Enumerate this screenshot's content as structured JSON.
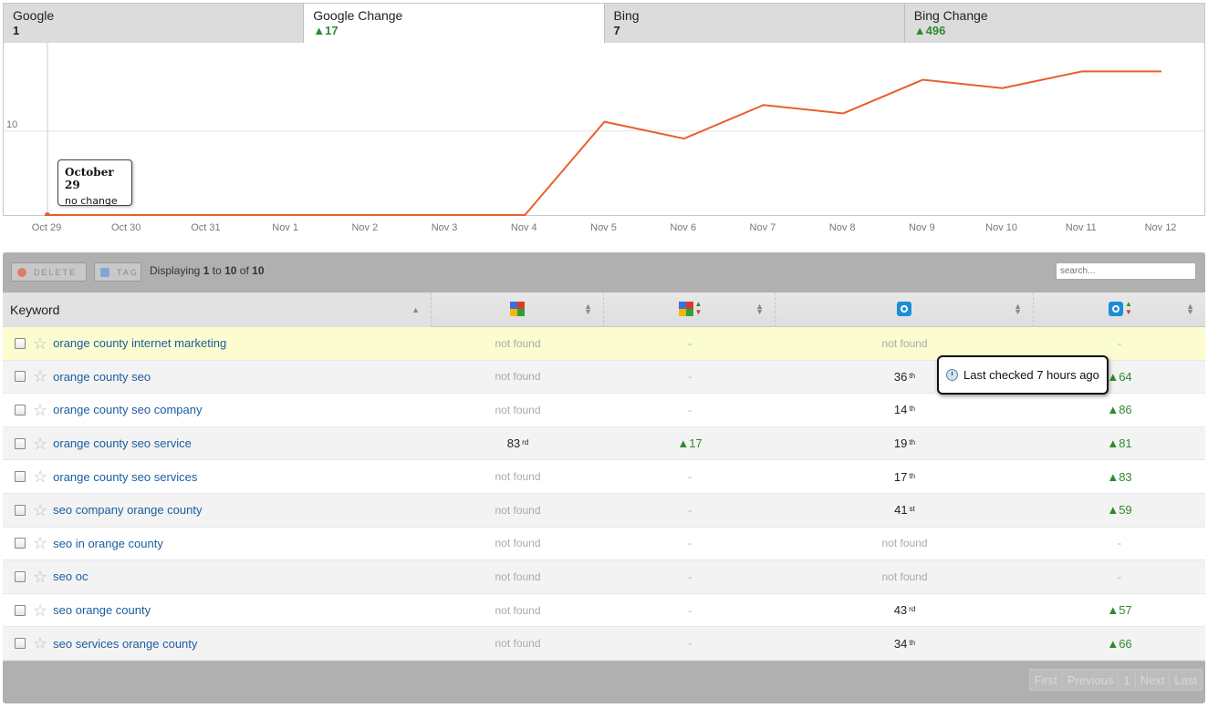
{
  "tabs": [
    {
      "label": "Google",
      "value": "1",
      "active": false,
      "positive": false
    },
    {
      "label": "Google Change",
      "value": "▲17",
      "active": true,
      "positive": true
    },
    {
      "label": "Bing",
      "value": "7",
      "active": false,
      "positive": false
    },
    {
      "label": "Bing Change",
      "value": "▲496",
      "active": false,
      "positive": true
    }
  ],
  "chart_data": {
    "type": "line",
    "categories": [
      "Oct 29",
      "Oct 30",
      "Oct 31",
      "Nov 1",
      "Nov 2",
      "Nov 3",
      "Nov 4",
      "Nov 5",
      "Nov 6",
      "Nov 7",
      "Nov 8",
      "Nov 9",
      "Nov 10",
      "Nov 11",
      "Nov 12"
    ],
    "values": [
      0,
      0,
      0,
      0,
      0,
      0,
      0,
      11.1,
      9.1,
      13.1,
      12.1,
      16.1,
      15.1,
      17.1,
      17.1
    ],
    "y_tick_labels": [
      "10"
    ],
    "ylim": [
      0,
      20.5
    ],
    "grid": true,
    "line_color": "#e8602c",
    "tooltip": {
      "title": "October 29",
      "text": "no change"
    }
  },
  "toolbar": {
    "delete_label": "DELETE",
    "tag_label": "TAG",
    "displaying_prefix": "Displaying",
    "displaying_from": "1",
    "displaying_to_word": "to",
    "displaying_to": "10",
    "displaying_of_word": "of",
    "displaying_total": "10",
    "search_placeholder": "search..."
  },
  "table": {
    "keyword_header": "Keyword",
    "rows": [
      {
        "keyword": "orange county internet marketing",
        "google": "not found",
        "google_sup": "",
        "gchange": "-",
        "bing": "not found",
        "bing_sup": "",
        "bchange": "-"
      },
      {
        "keyword": "orange county seo",
        "google": "not found",
        "google_sup": "",
        "gchange": "-",
        "bing": "36",
        "bing_sup": "th",
        "bchange": "▲64"
      },
      {
        "keyword": "orange county seo company",
        "google": "not found",
        "google_sup": "",
        "gchange": "-",
        "bing": "14",
        "bing_sup": "th",
        "bchange": "▲86"
      },
      {
        "keyword": "orange county seo service",
        "google": "83",
        "google_sup": "rd",
        "gchange": "▲17",
        "bing": "19",
        "bing_sup": "th",
        "bchange": "▲81"
      },
      {
        "keyword": "orange county seo services",
        "google": "not found",
        "google_sup": "",
        "gchange": "-",
        "bing": "17",
        "bing_sup": "th",
        "bchange": "▲83"
      },
      {
        "keyword": "seo company orange county",
        "google": "not found",
        "google_sup": "",
        "gchange": "-",
        "bing": "41",
        "bing_sup": "st",
        "bchange": "▲59"
      },
      {
        "keyword": "seo in orange county",
        "google": "not found",
        "google_sup": "",
        "gchange": "-",
        "bing": "not found",
        "bing_sup": "",
        "bchange": "-"
      },
      {
        "keyword": "seo oc",
        "google": "not found",
        "google_sup": "",
        "gchange": "-",
        "bing": "not found",
        "bing_sup": "",
        "bchange": "-"
      },
      {
        "keyword": "seo orange county",
        "google": "not found",
        "google_sup": "",
        "gchange": "-",
        "bing": "43",
        "bing_sup": "rd",
        "bchange": "▲57"
      },
      {
        "keyword": "seo services orange county",
        "google": "not found",
        "google_sup": "",
        "gchange": "-",
        "bing": "34",
        "bing_sup": "th",
        "bchange": "▲66"
      }
    ]
  },
  "last_checked": "Last checked 7 hours ago",
  "pager": [
    "First",
    "Previous",
    "1",
    "Next",
    "Last"
  ]
}
